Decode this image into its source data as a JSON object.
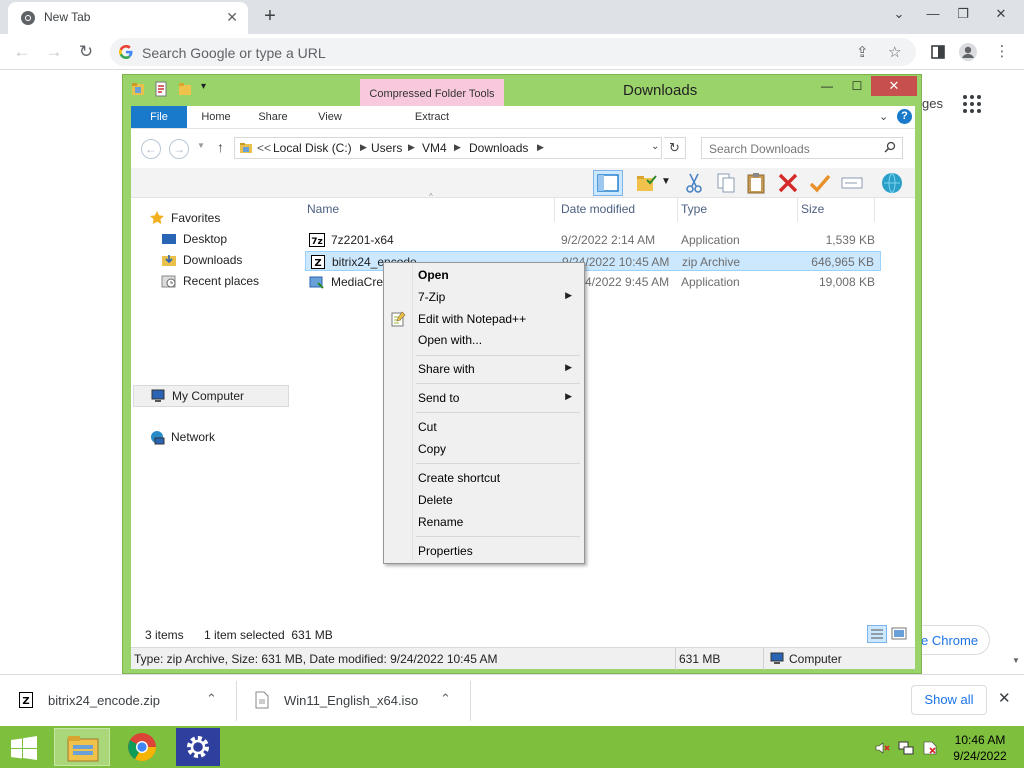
{
  "chrome": {
    "tab_title": "New Tab",
    "omnibox_placeholder": "Search Google or type a URL",
    "page_partial_text": "ges",
    "customize_label": "e Chrome"
  },
  "explorer": {
    "title": "Downloads",
    "contextual_tab_group": "Compressed Folder Tools",
    "ribbon_tabs": [
      "File",
      "Home",
      "Share",
      "View",
      "Extract"
    ],
    "breadcrumb": {
      "overflow": "<<",
      "parts": [
        "Local Disk (C:)",
        "Users",
        "VM4",
        "Downloads"
      ]
    },
    "search_placeholder": "Search Downloads",
    "nav": {
      "favorites": "Favorites",
      "desktop": "Desktop",
      "downloads": "Downloads",
      "recent": "Recent places",
      "computer": "My Computer",
      "network": "Network"
    },
    "columns": [
      "Name",
      "Date modified",
      "Type",
      "Size"
    ],
    "files": [
      {
        "name": "7z2201-x64",
        "date": "9/2/2022 2:14 AM",
        "type": "Application",
        "size": "1,539 KB"
      },
      {
        "name": "bitrix24_encode",
        "date": "9/24/2022 10:45 AM",
        "type": "zip Archive",
        "size": "646,965 KB"
      },
      {
        "name": "MediaCrea",
        "date": "/24/2022 9:45 AM",
        "type": "Application",
        "size": "19,008 KB"
      }
    ],
    "status": {
      "items": "3 items",
      "selected": "1 item selected  631 MB"
    },
    "details": {
      "info": "Type: zip Archive, Size: 631 MB, Date modified: 9/24/2022 10:45 AM",
      "size": "631 MB",
      "location": "Computer"
    }
  },
  "context_menu": {
    "open": "Open",
    "seven_zip": "7-Zip",
    "notepad": "Edit with Notepad++",
    "open_with": "Open with...",
    "share_with": "Share with",
    "send_to": "Send to",
    "cut": "Cut",
    "copy": "Copy",
    "create_shortcut": "Create shortcut",
    "delete": "Delete",
    "rename": "Rename",
    "properties": "Properties"
  },
  "downloads": {
    "items": [
      "bitrix24_encode.zip",
      "Win11_English_x64.iso"
    ],
    "show_all": "Show all"
  },
  "taskbar": {
    "time": "10:46 AM",
    "date": "9/24/2022"
  },
  "colors": {
    "window_frame": "#9bd36b",
    "taskbar": "#7fbf3e",
    "file_tab": "#1979ca",
    "close_button": "#c7504e",
    "contextual_tab": "#f8c9dd",
    "selection": "#cce8ff"
  }
}
